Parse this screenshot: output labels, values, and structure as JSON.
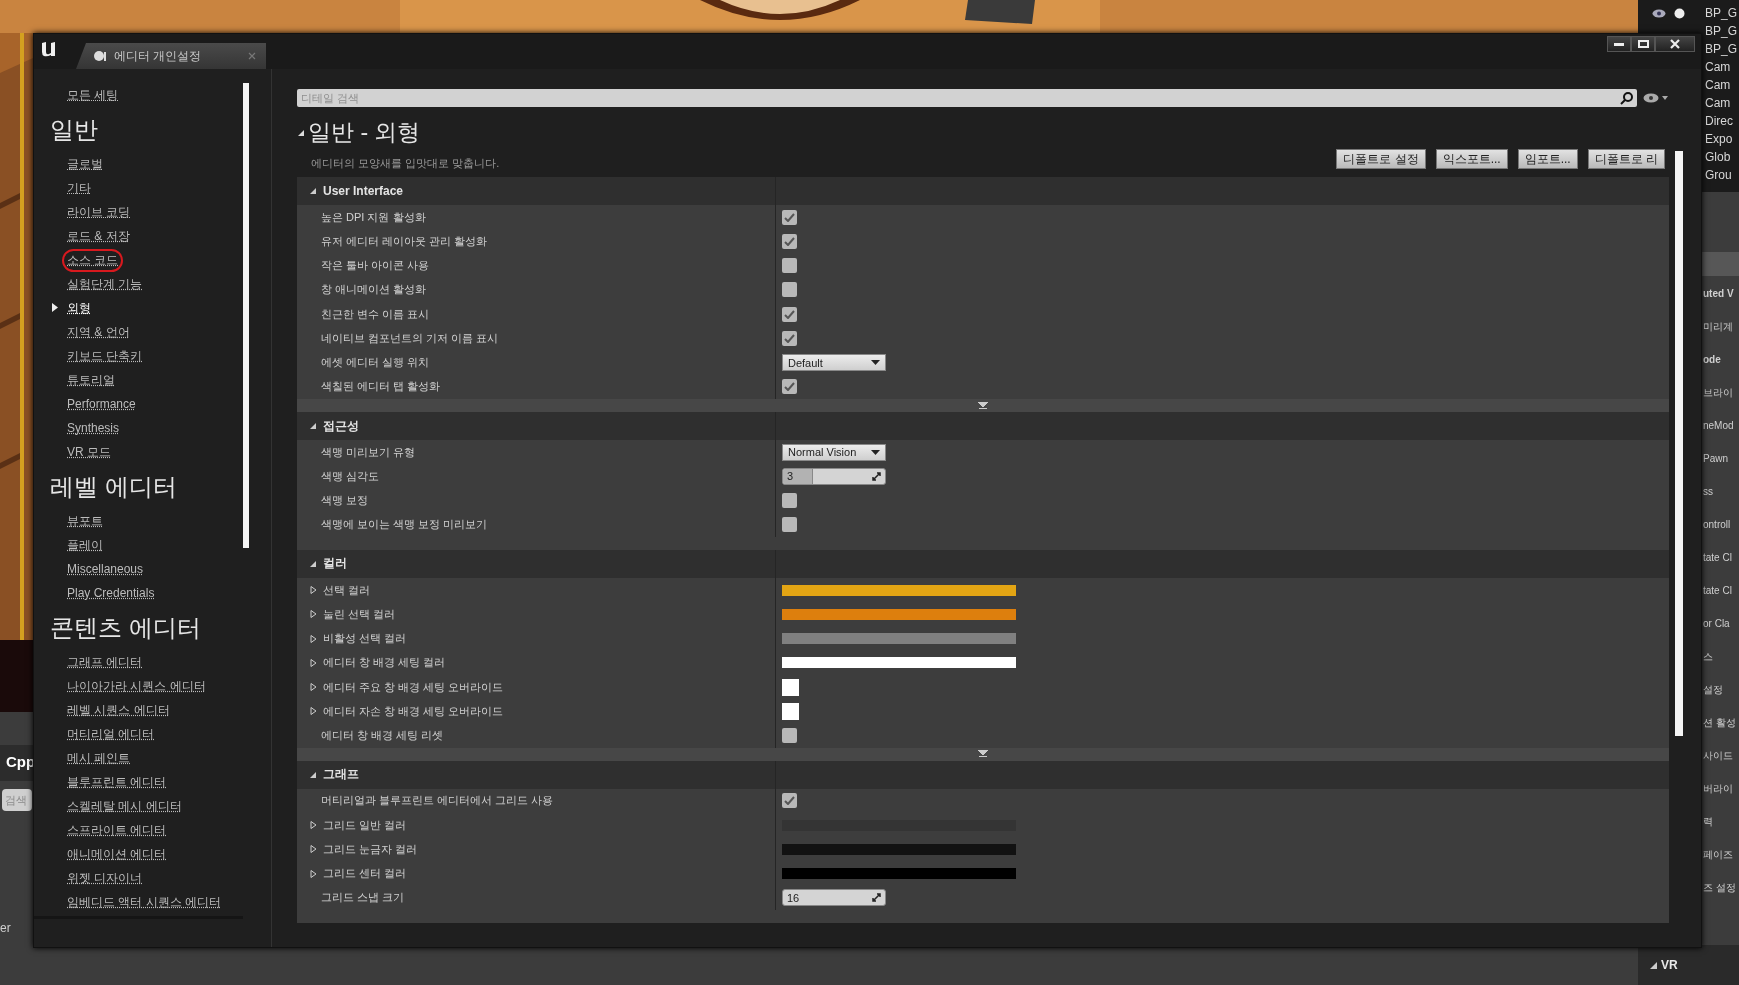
{
  "background": {
    "left_panel": {
      "title": "Cpp",
      "search_placeholder": "검색",
      "footer": "er"
    },
    "outliner": [
      "BP_G",
      "BP_G",
      "BP_G",
      "Cam",
      "Cam",
      "Cam",
      "Direc",
      "Expo",
      "Glob",
      "Grou"
    ],
    "details": [
      {
        "text": "uted V",
        "kind": "heading"
      },
      {
        "text": "미리계",
        "kind": "label"
      },
      {
        "text": "ode",
        "kind": "heading"
      },
      {
        "text": "브라이",
        "kind": "label"
      },
      {
        "text": "neMod",
        "kind": "label"
      },
      {
        "text": "Pawn",
        "kind": "label"
      },
      {
        "text": "ss",
        "kind": "label"
      },
      {
        "text": "ontroll",
        "kind": "label"
      },
      {
        "text": "tate Cl",
        "kind": "label"
      },
      {
        "text": "tate Cl",
        "kind": "label"
      },
      {
        "text": "or Cla",
        "kind": "label"
      },
      {
        "text": "스",
        "kind": "label"
      },
      {
        "text": "설정",
        "kind": "label"
      },
      {
        "text": "션 활성",
        "kind": "label"
      },
      {
        "text": "사이드",
        "kind": "label"
      },
      {
        "text": "버라이",
        "kind": "label"
      },
      {
        "text": "력",
        "kind": "label"
      },
      {
        "text": "페이즈",
        "kind": "label"
      },
      {
        "text": "즈 설정",
        "kind": "label"
      }
    ],
    "bottom_section": "VR"
  },
  "window": {
    "tab": "에디터 개인설정"
  },
  "sidebar": {
    "all_settings": "모든 세팅",
    "categories": [
      {
        "title": "일반",
        "items": [
          {
            "label": "글로벌",
            "selected": false,
            "circled": false
          },
          {
            "label": "기타",
            "selected": false,
            "circled": false
          },
          {
            "label": "라이브 코딩",
            "selected": false,
            "circled": false
          },
          {
            "label": "로드 & 저장",
            "selected": false,
            "circled": false
          },
          {
            "label": "소스 코드",
            "selected": false,
            "circled": true
          },
          {
            "label": "실험단계 기능",
            "selected": false,
            "circled": false
          },
          {
            "label": "외형",
            "selected": true,
            "circled": false
          },
          {
            "label": "지역 & 언어",
            "selected": false,
            "circled": false
          },
          {
            "label": "키보드 단축키",
            "selected": false,
            "circled": false
          },
          {
            "label": "튜토리얼",
            "selected": false,
            "circled": false
          },
          {
            "label": "Performance",
            "selected": false,
            "circled": false
          },
          {
            "label": "Synthesis",
            "selected": false,
            "circled": false
          },
          {
            "label": "VR 모드",
            "selected": false,
            "circled": false
          }
        ]
      },
      {
        "title": "레벨 에디터",
        "items": [
          {
            "label": "뷰포트",
            "selected": false,
            "circled": false
          },
          {
            "label": "플레이",
            "selected": false,
            "circled": false
          },
          {
            "label": "Miscellaneous",
            "selected": false,
            "circled": false
          },
          {
            "label": "Play Credentials",
            "selected": false,
            "circled": false
          }
        ]
      },
      {
        "title": "콘텐츠 에디터",
        "items": [
          {
            "label": "그래프 에디터",
            "selected": false,
            "circled": false
          },
          {
            "label": "나이아가라 시퀀스 에디터",
            "selected": false,
            "circled": false
          },
          {
            "label": "레벨 시퀀스 에디터",
            "selected": false,
            "circled": false
          },
          {
            "label": "머티리얼 에디터",
            "selected": false,
            "circled": false
          },
          {
            "label": "메시 페인트",
            "selected": false,
            "circled": false
          },
          {
            "label": "블루프린트 에디터",
            "selected": false,
            "circled": false
          },
          {
            "label": "스켈레탈 메시 에디터",
            "selected": false,
            "circled": false
          },
          {
            "label": "스프라이트 에디터",
            "selected": false,
            "circled": false
          },
          {
            "label": "애니메이션 에디터",
            "selected": false,
            "circled": false
          },
          {
            "label": "위젯 디자이너",
            "selected": false,
            "circled": false
          },
          {
            "label": "임베디드 액터 시퀀스 에디터",
            "selected": false,
            "circled": false
          }
        ]
      }
    ]
  },
  "search": {
    "placeholder": "디테일 검색"
  },
  "page": {
    "title": "일반 - 외형",
    "description": "에디터의 모양새를 입맛대로 맞춥니다.",
    "buttons": [
      "디폴트로 설정",
      "익스포트...",
      "임포트...",
      "디폴트로 리"
    ]
  },
  "sections": [
    {
      "title": "User Interface",
      "advanced": true,
      "rows": [
        {
          "label": "높은 DPI 지원 활성화",
          "kind": "checkbox",
          "checked": true
        },
        {
          "label": "유저 에디터 레이아웃 관리 활성화",
          "kind": "checkbox",
          "checked": true
        },
        {
          "label": "작은 툴바 아이콘 사용",
          "kind": "checkbox",
          "checked": false
        },
        {
          "label": "창 애니메이션 활성화",
          "kind": "checkbox",
          "checked": false
        },
        {
          "label": "친근한 변수 이름 표시",
          "kind": "checkbox",
          "checked": true
        },
        {
          "label": "네이티브 컴포넌트의 기저 이름 표시",
          "kind": "checkbox",
          "checked": true
        },
        {
          "label": "에셋 에디터 실행 위치",
          "kind": "dropdown",
          "value": "Default"
        },
        {
          "label": "색칠된 에디터 탭 활성화",
          "kind": "checkbox",
          "checked": true
        }
      ]
    },
    {
      "title": "접근성",
      "advanced": false,
      "rows": [
        {
          "label": "색맹 미리보기 유형",
          "kind": "dropdown",
          "value": "Normal Vision"
        },
        {
          "label": "색맹 심각도",
          "kind": "spinner",
          "value": "3",
          "level": 0.29
        },
        {
          "label": "색맹 보정",
          "kind": "checkbox",
          "checked": false
        },
        {
          "label": "색맹에 보이는 색맹 보정 미리보기",
          "kind": "checkbox",
          "checked": false
        }
      ]
    },
    {
      "title": "컬러",
      "advanced": true,
      "rows": [
        {
          "label": "선택 컬러",
          "kind": "color_bar",
          "color": "#e3a514",
          "expandable": true
        },
        {
          "label": "눌린 선택 컬러",
          "kind": "color_bar",
          "color": "#dd7f0d",
          "expandable": true
        },
        {
          "label": "비활성 선택 컬러",
          "kind": "color_bar",
          "color": "#808080",
          "expandable": true
        },
        {
          "label": "에디터 창 배경 세팅 컬러",
          "kind": "color_bar",
          "color": "#ffffff",
          "expandable": true
        },
        {
          "label": "에디터 주요 창 배경 세팅 오버라이드",
          "kind": "color_swatch",
          "color": "#ffffff",
          "expandable": true
        },
        {
          "label": "에디터 자손 창 배경 세팅 오버라이드",
          "kind": "color_swatch",
          "color": "#ffffff",
          "expandable": true
        },
        {
          "label": "에디터 창 배경 세팅 리셋",
          "kind": "checkbox",
          "checked": false
        }
      ]
    },
    {
      "title": "그래프",
      "advanced": false,
      "rows": [
        {
          "label": "머티리얼과 블루프린트 에디터에서 그리드 사용",
          "kind": "checkbox",
          "checked": true
        },
        {
          "label": "그리드 일반 컬러",
          "kind": "color_bar",
          "color": "#343434",
          "expandable": true
        },
        {
          "label": "그리드 눈금자 컬러",
          "kind": "color_bar",
          "color": "#121212",
          "expandable": true
        },
        {
          "label": "그리드 센터 컬러",
          "kind": "color_bar",
          "color": "#000000",
          "expandable": true
        },
        {
          "label": "그리드 스냅 크기",
          "kind": "spinner",
          "value": "16"
        }
      ]
    }
  ]
}
